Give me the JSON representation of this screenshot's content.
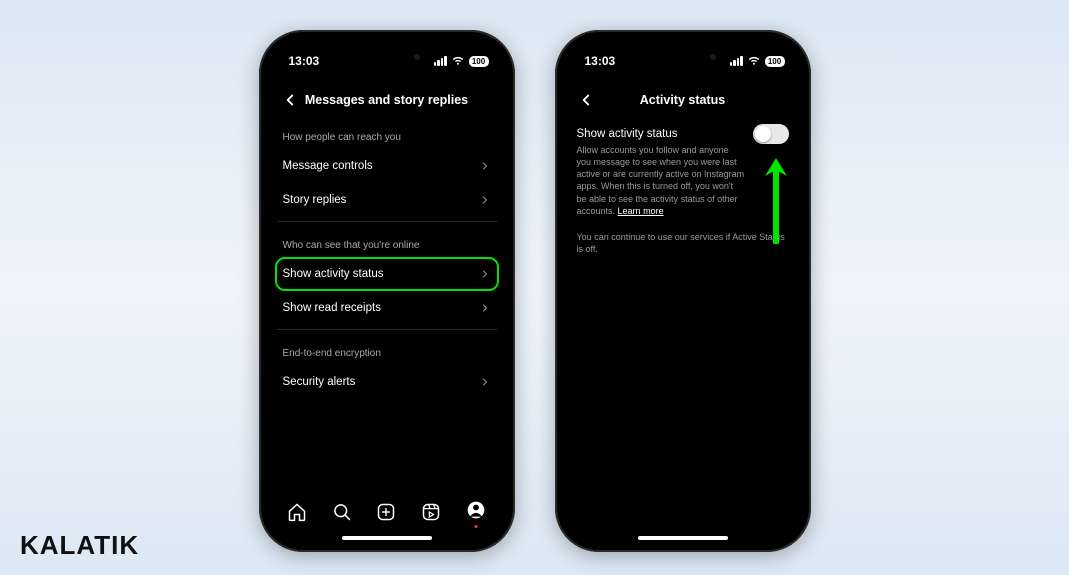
{
  "brand": "KALATIK",
  "status": {
    "time": "13:03",
    "battery": "100"
  },
  "phone1": {
    "header_title": "Messages and story replies",
    "sections": {
      "reach": {
        "label": "How people can reach you",
        "items": {
          "message_controls": "Message controls",
          "story_replies": "Story replies"
        }
      },
      "online": {
        "label": "Who can see that you're online",
        "items": {
          "show_activity": "Show activity status",
          "read_receipts": "Show read receipts"
        }
      },
      "encryption": {
        "label": "End-to-end encryption",
        "items": {
          "security_alerts": "Security alerts"
        }
      }
    }
  },
  "phone2": {
    "header_title": "Activity status",
    "setting_title": "Show activity status",
    "setting_desc": "Allow accounts you follow and anyone you message to see when you were last active or are currently active on Instagram apps. When this is turned off, you won't be able to see the activity status of other accounts.",
    "learn_more": "Learn more",
    "note": "You can continue to use our services if Active Status is off.",
    "toggle_on": false
  }
}
